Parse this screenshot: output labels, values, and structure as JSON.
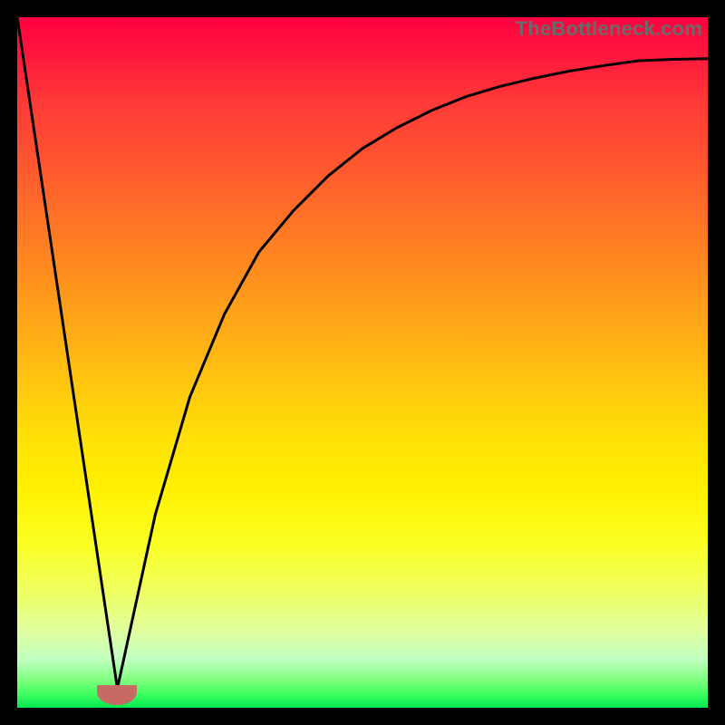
{
  "watermark": "TheBottleneck.com",
  "colors": {
    "page_bg": "#000000",
    "curve": "#000000",
    "marker": "#c76a64",
    "gradient_top": "#ff0040",
    "gradient_bottom": "#00e850"
  },
  "marker": {
    "x_frac": 0.145,
    "y_frac": 0.972
  },
  "chart_data": {
    "type": "line",
    "title": "",
    "xlabel": "",
    "ylabel": "",
    "xlim": [
      0,
      100
    ],
    "ylim": [
      0,
      100
    ],
    "grid": false,
    "series": [
      {
        "name": "left-slope",
        "x": [
          0,
          14.5
        ],
        "values": [
          100,
          2.8
        ]
      },
      {
        "name": "right-curve",
        "x": [
          14.5,
          20,
          25,
          30,
          35,
          40,
          45,
          50,
          55,
          60,
          65,
          70,
          75,
          80,
          85,
          90,
          95,
          100
        ],
        "values": [
          2.8,
          28,
          45,
          57,
          66,
          72,
          77,
          81,
          84,
          86.5,
          88.5,
          90,
          91.2,
          92.2,
          93,
          93.7,
          93.9,
          94
        ]
      }
    ],
    "annotations": [
      {
        "name": "minimum-marker",
        "x": 14.5,
        "y": 2.8
      }
    ]
  }
}
